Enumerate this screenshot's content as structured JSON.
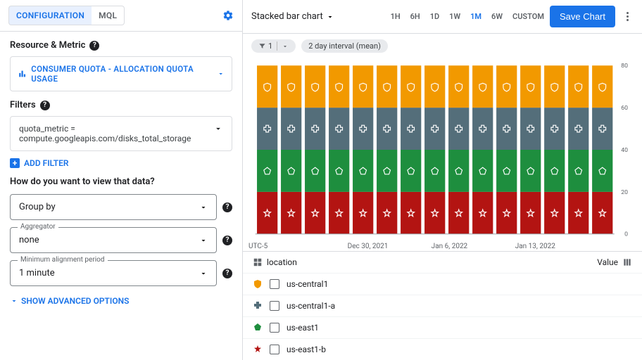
{
  "tabs": {
    "config": "CONFIGURATION",
    "mql": "MQL"
  },
  "left": {
    "resource_metric_title": "Resource & Metric",
    "metric_chip": "CONSUMER QUOTA - ALLOCATION QUOTA USAGE",
    "filters_title": "Filters",
    "filter_text": "quota_metric = compute.googleapis.com/disks_total_storage",
    "add_filter": "ADD FILTER",
    "view_question": "How do you want to view that data?",
    "group_by": {
      "label": "Group by"
    },
    "aggregator": {
      "legend": "Aggregator",
      "value": "none"
    },
    "min_align": {
      "legend": "Minimum alignment period",
      "value": "1 minute"
    },
    "advanced": "SHOW ADVANCED OPTIONS"
  },
  "right": {
    "chart_type": "Stacked bar chart",
    "ranges": [
      "1H",
      "6H",
      "1D",
      "1W",
      "1M",
      "6W",
      "CUSTOM"
    ],
    "active_range": "1M",
    "save": "Save Chart",
    "filter_chip_count": "1",
    "interval_chip": "2 day interval (mean)",
    "tz": "UTC-5",
    "x_ticks": [
      "Dec 30, 2021",
      "Jan 6, 2022",
      "Jan 13, 2022"
    ],
    "legend_header": "location",
    "value_header": "Value",
    "legend": [
      {
        "name": "us-central1",
        "shape": "shield",
        "color": "#f29900"
      },
      {
        "name": "us-central1-a",
        "shape": "cross",
        "color": "#546e7a"
      },
      {
        "name": "us-east1",
        "shape": "pentagon",
        "color": "#1e8e3e"
      },
      {
        "name": "us-east1-b",
        "shape": "star",
        "color": "#b31412"
      }
    ]
  },
  "chart_data": {
    "type": "bar",
    "stacked": true,
    "ylim": [
      0,
      80
    ],
    "y_ticks": [
      0,
      20,
      40,
      60,
      80
    ],
    "bar_count": 15,
    "series": [
      {
        "name": "us-east1-b",
        "color": "#b31412",
        "value_each": 20,
        "shape": "star"
      },
      {
        "name": "us-east1",
        "color": "#1e8e3e",
        "value_each": 20,
        "shape": "pentagon"
      },
      {
        "name": "us-central1-a",
        "color": "#546e7a",
        "value_each": 20,
        "shape": "cross"
      },
      {
        "name": "us-central1",
        "color": "#f29900",
        "value_each": 20,
        "shape": "shield"
      }
    ]
  }
}
